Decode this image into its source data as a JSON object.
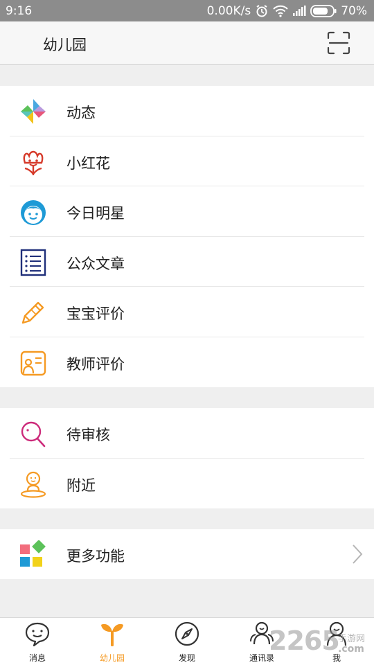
{
  "status_bar": {
    "time": "9:16",
    "network_speed": "0.00K/s",
    "battery": "70%",
    "icons": [
      "alarm-icon",
      "wifi-icon",
      "signal-icon",
      "battery-icon"
    ]
  },
  "header": {
    "title": "幼儿园",
    "action_icon": "scan-icon"
  },
  "menu_groups": [
    {
      "items": [
        {
          "label": "动态",
          "icon": "pinwheel-icon"
        },
        {
          "label": "小红花",
          "icon": "flower-icon"
        },
        {
          "label": "今日明星",
          "icon": "boy-face-icon"
        },
        {
          "label": "公众文章",
          "icon": "article-list-icon"
        },
        {
          "label": "宝宝评价",
          "icon": "pencil-icon"
        },
        {
          "label": "教师评价",
          "icon": "teacher-board-icon"
        }
      ]
    },
    {
      "items": [
        {
          "label": "待审核",
          "icon": "magnifier-icon"
        },
        {
          "label": "附近",
          "icon": "location-person-icon"
        }
      ]
    },
    {
      "items": [
        {
          "label": "更多功能",
          "icon": "more-blocks-icon",
          "chevron": true
        }
      ]
    }
  ],
  "tab_bar": {
    "tabs": [
      {
        "label": "消息",
        "icon": "chat-bubble-icon",
        "active": false
      },
      {
        "label": "幼儿园",
        "icon": "sprout-icon",
        "active": true
      },
      {
        "label": "发现",
        "icon": "compass-icon",
        "active": false
      },
      {
        "label": "通讯录",
        "icon": "contacts-icon",
        "active": false
      },
      {
        "label": "我",
        "icon": "user-icon",
        "active": false
      }
    ]
  },
  "watermark": {
    "number": "2265",
    "line1": "手游网",
    "line2": ".com"
  },
  "colors": {
    "status_bar": "#8c8c8c",
    "accent": "#f59a23",
    "background": "#efefef",
    "flower_red": "#d63a2a",
    "star_blue": "#1e9ad6",
    "article_navy": "#1f2f7a",
    "pending_magenta": "#cc2a7a"
  }
}
